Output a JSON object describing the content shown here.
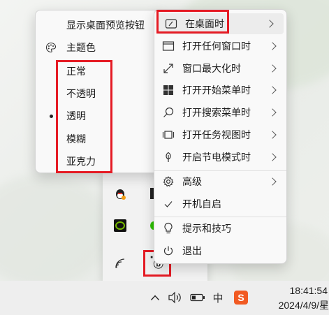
{
  "left_menu": {
    "items": [
      {
        "label": "显示桌面预览按钮"
      },
      {
        "label": "主题色",
        "icon": "palette-icon"
      },
      {
        "label": "正常"
      },
      {
        "label": "不透明"
      },
      {
        "label": "透明",
        "selected": true
      },
      {
        "label": "模糊"
      },
      {
        "label": "亚克力"
      }
    ]
  },
  "right_menu": {
    "items": [
      {
        "label": "在桌面时",
        "icon": "desktop-icon",
        "submenu": true
      },
      {
        "label": "打开任何窗口时",
        "icon": "window-icon",
        "submenu": true
      },
      {
        "label": "窗口最大化时",
        "icon": "maximize-icon",
        "submenu": true
      },
      {
        "label": "打开开始菜单时",
        "icon": "windows-logo-icon",
        "submenu": true
      },
      {
        "label": "打开搜索菜单时",
        "icon": "search-icon",
        "submenu": true
      },
      {
        "label": "打开任务视图时",
        "icon": "task-view-icon",
        "submenu": true
      },
      {
        "label": "开启节电模式时",
        "icon": "leaf-icon",
        "submenu": true
      },
      {
        "label": "高级",
        "icon": "gear-icon",
        "submenu": true
      },
      {
        "label": "开机自启",
        "icon": "check-icon",
        "submenu": false
      },
      {
        "label": "提示和技巧",
        "icon": "lightbulb-icon",
        "submenu": false
      },
      {
        "label": "退出",
        "icon": "power-icon",
        "submenu": false
      }
    ]
  },
  "taskbar": {
    "time": "18:41:54",
    "date": "2024/4/9/星",
    "ime": "中",
    "sogou": "S"
  },
  "colors": {
    "highlight_box": "#e51b24",
    "menu_bg": "#f9f9f9"
  }
}
